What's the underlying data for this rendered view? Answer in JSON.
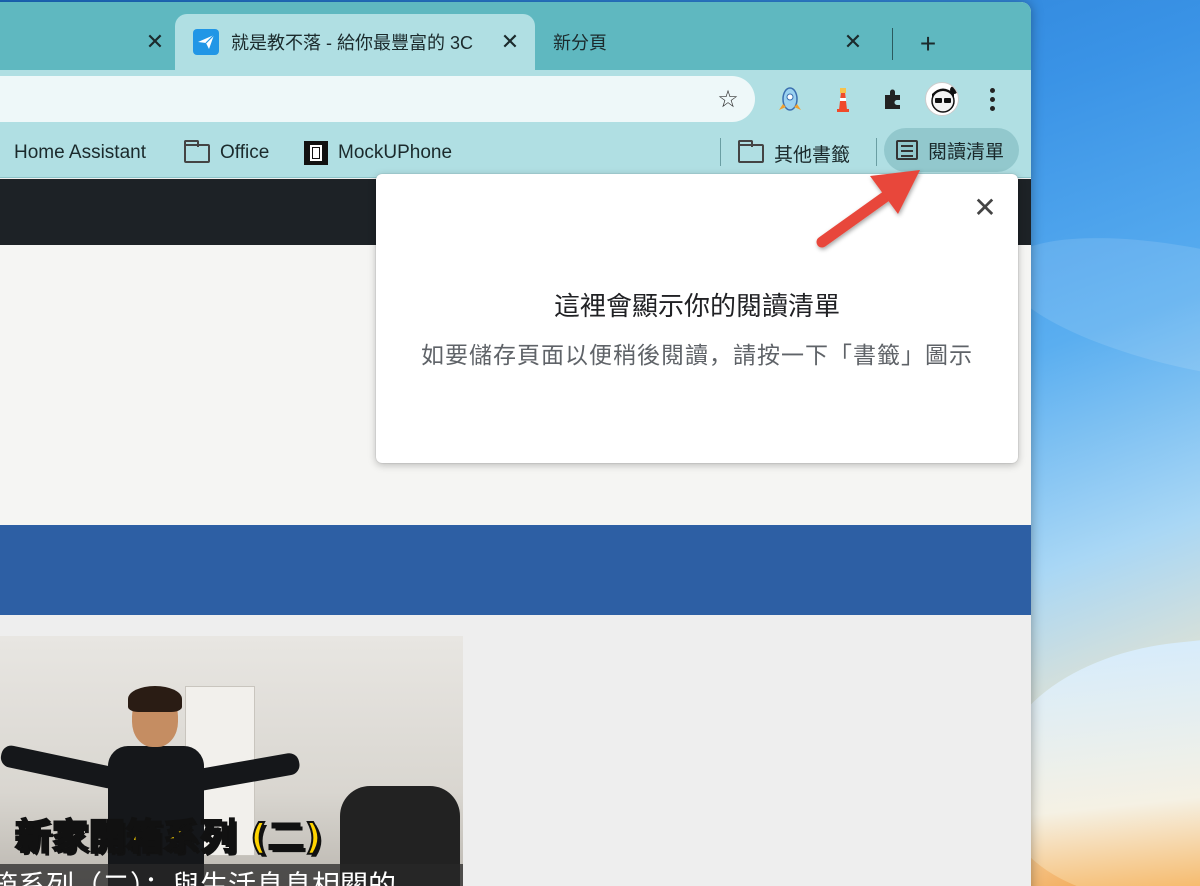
{
  "tabs": [
    {
      "title": ""
    },
    {
      "title": "就是教不落 - 給你最豐富的 3C",
      "active": true
    },
    {
      "title": "新分頁"
    }
  ],
  "tab_close_glyph": "✕",
  "new_tab_glyph": "+",
  "toolbar": {
    "star_icon": "star-icon",
    "extensions": [
      "rocket-extension-icon",
      "lighthouse-extension-icon",
      "puzzle-extensions-icon"
    ]
  },
  "bookmarks": {
    "items": [
      {
        "label": "Home Assistant",
        "icon": "none"
      },
      {
        "label": "Office",
        "icon": "folder-icon"
      },
      {
        "label": "MockUPhone",
        "icon": "mockuphone-icon"
      }
    ],
    "other_bookmarks": "其他書籤",
    "reading_list": "閱讀清單"
  },
  "popup": {
    "title": "這裡會顯示你的閱讀清單",
    "description": "如要儲存頁面以便稍後閱讀，請按一下「書籤」圖示"
  },
  "thumbnail": {
    "banner": "新家開箱系列 (二)",
    "caption": "箱系列（二）：與生活息息相關的"
  },
  "colors": {
    "tab_strip": "#5fb8c0",
    "toolbar": "#b0dfe3",
    "arrow": "#e8463a",
    "page_blue": "#2d5fa4"
  }
}
